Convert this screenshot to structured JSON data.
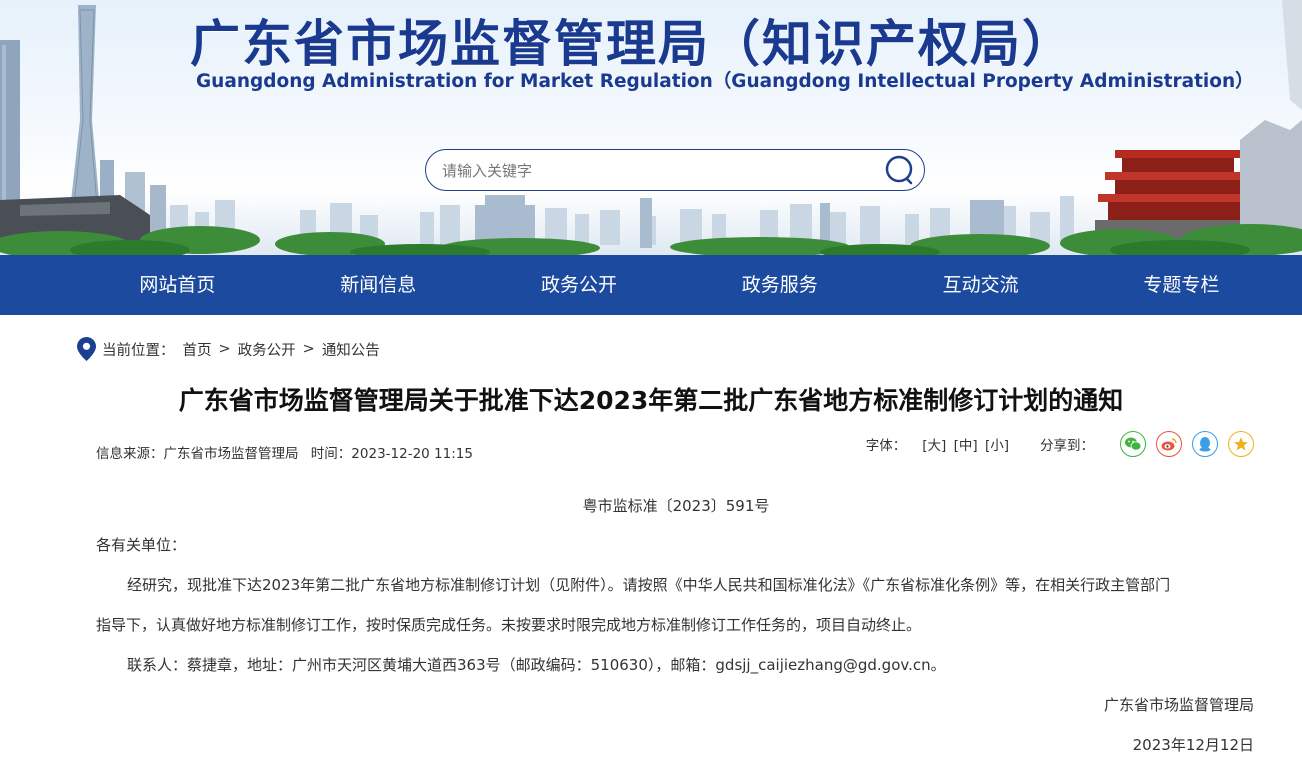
{
  "header": {
    "title_cn": "广东省市场监督管理局（知识产权局）",
    "title_en": "Guangdong Administration for Market Regulation（Guangdong Intellectual Property Administration）",
    "search_placeholder": "请输入关键字"
  },
  "nav": {
    "items": [
      "网站首页",
      "新闻信息",
      "政务公开",
      "政务服务",
      "互动交流",
      "专题专栏"
    ]
  },
  "breadcrumb": {
    "label": "当前位置：",
    "items": [
      "首页",
      "政务公开",
      "通知公告"
    ],
    "separator": ">"
  },
  "article": {
    "title": "广东省市场监督管理局关于批准下达2023年第二批广东省地方标准制修订计划的通知",
    "source_label": "信息来源：",
    "source": "广东省市场监督管理局",
    "time_label": "时间：",
    "time": "2023-12-20 11:15",
    "font_label": "字体：",
    "font_sizes": [
      "[大]",
      "[中]",
      "[小]"
    ],
    "share_label": "分享到：",
    "doc_number": "粤市监标准〔2023〕591号",
    "salutation": "各有关单位：",
    "paragraph1_line1": "经研究，现批准下达2023年第二批广东省地方标准制修订计划（见附件）。请按照《中华人民共和国标准化法》《广东省标准化条例》等，在相关行政主管部门",
    "paragraph1_line2": "指导下，认真做好地方标准制修订工作，按时保质完成任务。未按要求时限完成地方标准制修订工作任务的，项目自动终止。",
    "contact": "联系人：蔡捷章，地址：广州市天河区黄埔大道西363号（邮政编码：510630），邮箱：gdsjj_caijiezhang@gd.gov.cn。",
    "signature": "广东省市场监督管理局",
    "date": "2023年12月12日"
  },
  "colors": {
    "nav_bg": "#1c4a9f",
    "title_blue": "#1a3a8f",
    "wechat": "#3fb53f",
    "weibo": "#e6553a",
    "qq": "#3a9ee6",
    "qzone": "#f2b01e"
  }
}
